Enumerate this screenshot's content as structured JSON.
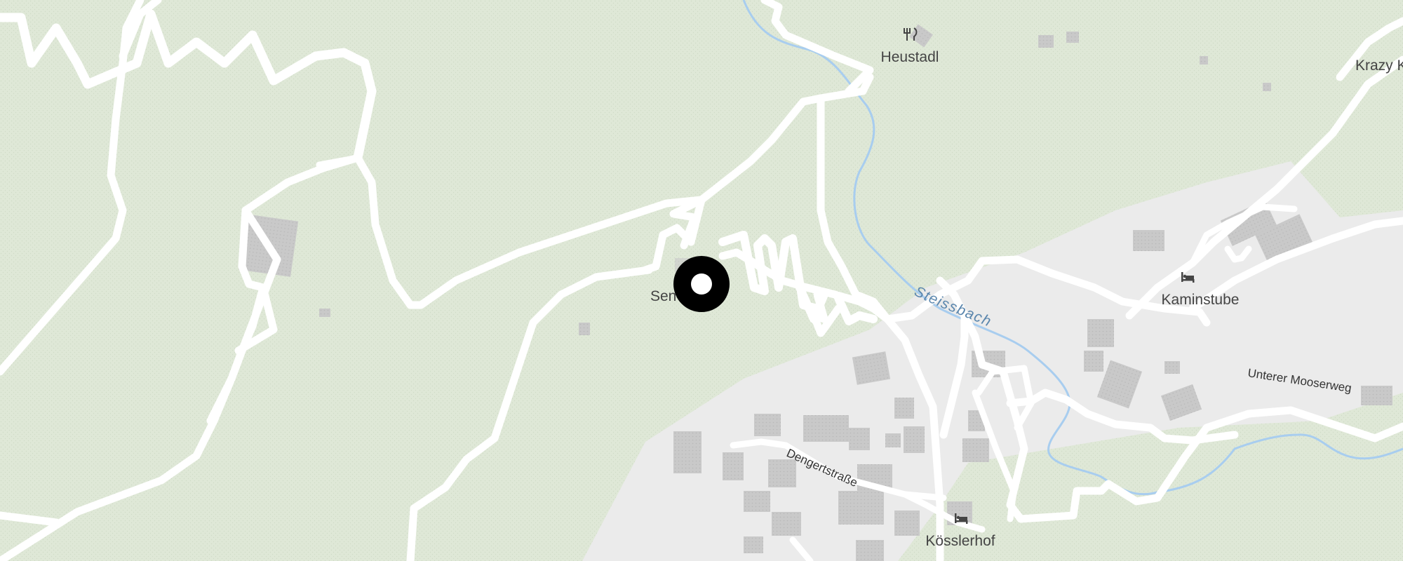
{
  "map": {
    "colors": {
      "forest": "#dfe8d7",
      "settlement": "#ebebeb",
      "road": "#ffffff",
      "building": "#c9c9c9",
      "water": "#a8cdef",
      "water_label": "#5a86ad",
      "label": "#444444",
      "marker": "#000000"
    },
    "water": {
      "stream_name": "Steissbach"
    },
    "streets": {
      "dengert": "Dengertstraße",
      "mooser": "Unterer Mooserweg"
    },
    "pois": {
      "heustadl": {
        "name": "Heustadl",
        "icon": "restaurant-icon"
      },
      "kaminstube": {
        "name": "Kaminstube",
        "icon": "lodging-icon"
      },
      "koesslerhof": {
        "name": "Kösslerhof",
        "icon": "lodging-icon"
      },
      "krazy": {
        "name": "Krazy K",
        "icon": "none"
      },
      "sen": {
        "name": "Sen",
        "icon": "none"
      }
    },
    "marker": {
      "icon": "location-pin-icon"
    }
  }
}
